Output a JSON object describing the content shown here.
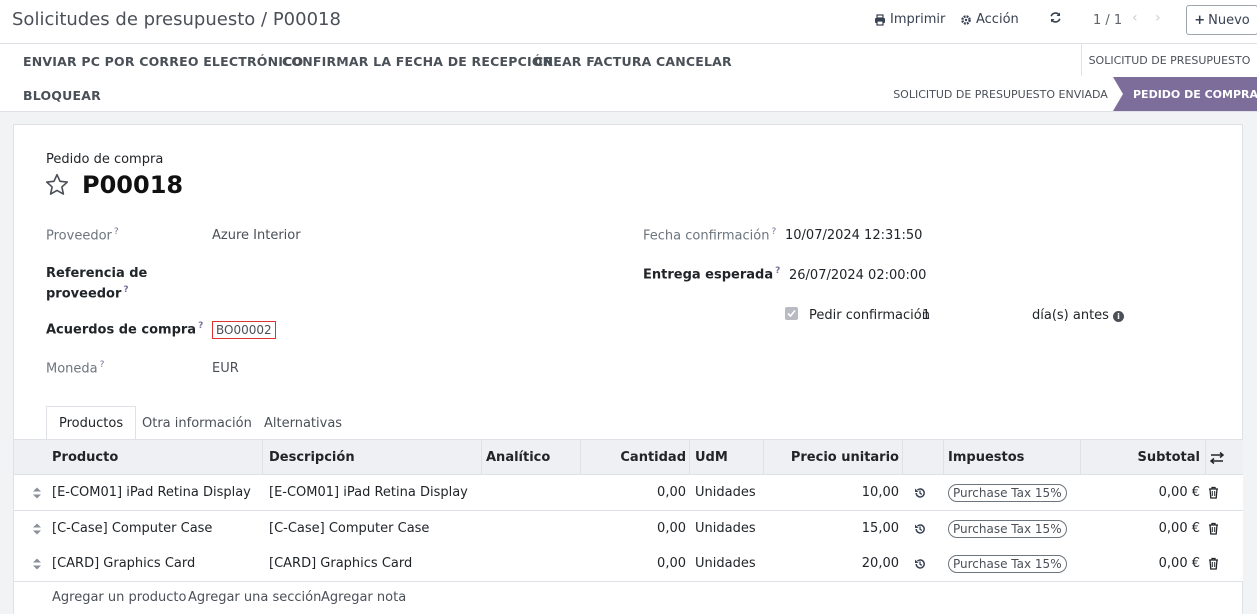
{
  "breadcrumb": {
    "parent": "Solicitudes de presupuesto",
    "separator": "/",
    "current": "P00018"
  },
  "control": {
    "print_label": "Imprimir",
    "action_label": "Acción",
    "pager": "1 / 1",
    "new_label": "Nuevo"
  },
  "actions": [
    "ENVIAR PC POR CORREO ELECTRÓNICO",
    "CONFIRMAR LA FECHA DE RECEPCIÓN",
    "CREAR FACTURA",
    "CANCELAR",
    "BLOQUEAR"
  ],
  "stages": {
    "top": "SOLICITUD DE PRESUPUESTO",
    "sent": "SOLICITUD DE PRESUPUESTO ENVIADA",
    "active": "PEDIDO DE COMPRA"
  },
  "form": {
    "doc_label": "Pedido de compra",
    "doc_name": "P00018",
    "vendor_label": "Proveedor",
    "vendor_value": "Azure Interior",
    "vendor_ref_label_1": "Referencia de",
    "vendor_ref_label_2": "proveedor",
    "agreement_label": "Acuerdos de compra",
    "agreement_value": "BO00002",
    "currency_label": "Moneda",
    "currency_value": "EUR",
    "confirm_date_label": "Fecha confirmación",
    "confirm_date_value": "10/07/2024 12:31:50",
    "expected_label": "Entrega esperada",
    "expected_value": "26/07/2024 02:00:00",
    "ask_confirm_label": "Pedir confirmación",
    "ask_confirm_days": "1",
    "ask_confirm_suffix": "día(s) antes",
    "help_mark": "?"
  },
  "tabs": [
    "Productos",
    "Otra información",
    "Alternativas"
  ],
  "table": {
    "headers": {
      "product": "Producto",
      "description": "Descripción",
      "analytic": "Analítico",
      "qty": "Cantidad",
      "uom": "UdM",
      "price": "Precio unitario",
      "taxes": "Impuestos",
      "subtotal": "Subtotal"
    },
    "rows": [
      {
        "product": "[E-COM01] iPad Retina Display",
        "description": "[E-COM01] iPad Retina Display",
        "qty": "0,00",
        "uom": "Unidades",
        "price": "10,00",
        "tax": "Purchase Tax 15%",
        "subtotal": "0,00 €"
      },
      {
        "product": "[C-Case] Computer Case",
        "description": "[C-Case] Computer Case",
        "qty": "0,00",
        "uom": "Unidades",
        "price": "15,00",
        "tax": "Purchase Tax 15%",
        "subtotal": "0,00 €"
      },
      {
        "product": "[CARD] Graphics Card",
        "description": "[CARD] Graphics Card",
        "qty": "0,00",
        "uom": "Unidades",
        "price": "20,00",
        "tax": "Purchase Tax 15%",
        "subtotal": "0,00 €"
      }
    ]
  },
  "add_links": {
    "product": "Agregar un producto",
    "section": "Agregar una sección",
    "note": "Agregar nota"
  },
  "colors": {
    "accent": "#7c6d9a",
    "stage_active_bg": "#7c6d9a",
    "error_border": "#dd3333"
  }
}
